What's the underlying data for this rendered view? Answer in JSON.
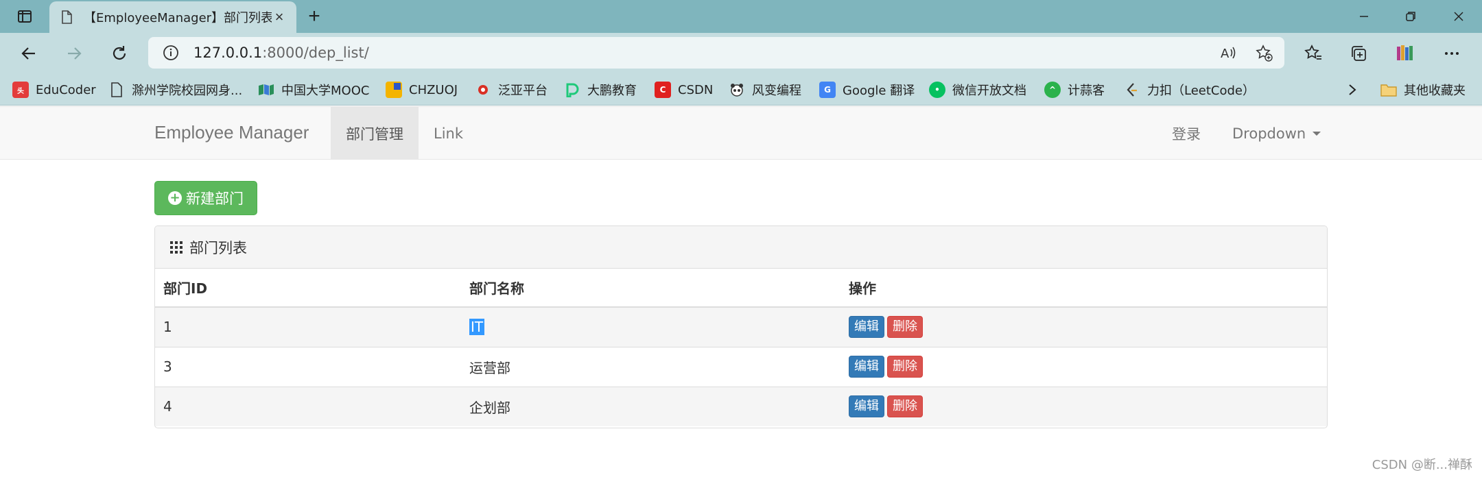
{
  "browser": {
    "tab_title": "【EmployeeManager】部门列表",
    "url_host": "127.0.0.1",
    "url_rest": ":8000/dep_list/",
    "bookmarks": [
      {
        "label": "EduCoder",
        "icon": "toutiao-icon",
        "color": "#e33b3b"
      },
      {
        "label": "滁州学院校园网身...",
        "icon": "page-icon",
        "color": "#555555"
      },
      {
        "label": "中国大学MOOC",
        "icon": "mooc-icon",
        "color": "#2a8f5a"
      },
      {
        "label": "CHZUOJ",
        "icon": "chzuoj-icon",
        "color": "#f4b400"
      },
      {
        "label": "泛亚平台",
        "icon": "fanya-icon",
        "color": "#d93025"
      },
      {
        "label": "大鹏教育",
        "icon": "dapeng-icon",
        "color": "#1ec97a"
      },
      {
        "label": "CSDN",
        "icon": "csdn-icon",
        "color": "#e0201f"
      },
      {
        "label": "风变编程",
        "icon": "panda-icon",
        "color": "#333333"
      },
      {
        "label": "Google 翻译",
        "icon": "google-translate-icon",
        "color": "#4285f4"
      },
      {
        "label": "微信开放文档",
        "icon": "wechat-icon",
        "color": "#07c160"
      },
      {
        "label": "计蒜客",
        "icon": "jisuanke-icon",
        "color": "#2bb24c"
      },
      {
        "label": "力扣（LeetCode）",
        "icon": "leetcode-icon",
        "color": "#333333"
      }
    ],
    "other_bookmarks": "其他收藏夹"
  },
  "navbar": {
    "brand": "Employee Manager",
    "links": [
      "部门管理",
      "Link"
    ],
    "login": "登录",
    "dropdown": "Dropdown"
  },
  "content": {
    "create_button": "新建部门",
    "panel_title": "部门列表",
    "columns": [
      "部门ID",
      "部门名称",
      "操作"
    ],
    "rows": [
      {
        "id": "1",
        "name": "IT"
      },
      {
        "id": "3",
        "name": "运营部"
      },
      {
        "id": "4",
        "name": "企划部"
      }
    ],
    "edit_label": "编辑",
    "delete_label": "删除"
  },
  "watermark": "CSDN @断...禅酥",
  "colors": {
    "success": "#5cb85c",
    "primary": "#337ab7",
    "danger": "#d9534f",
    "chrome": "#7fb5bd"
  }
}
